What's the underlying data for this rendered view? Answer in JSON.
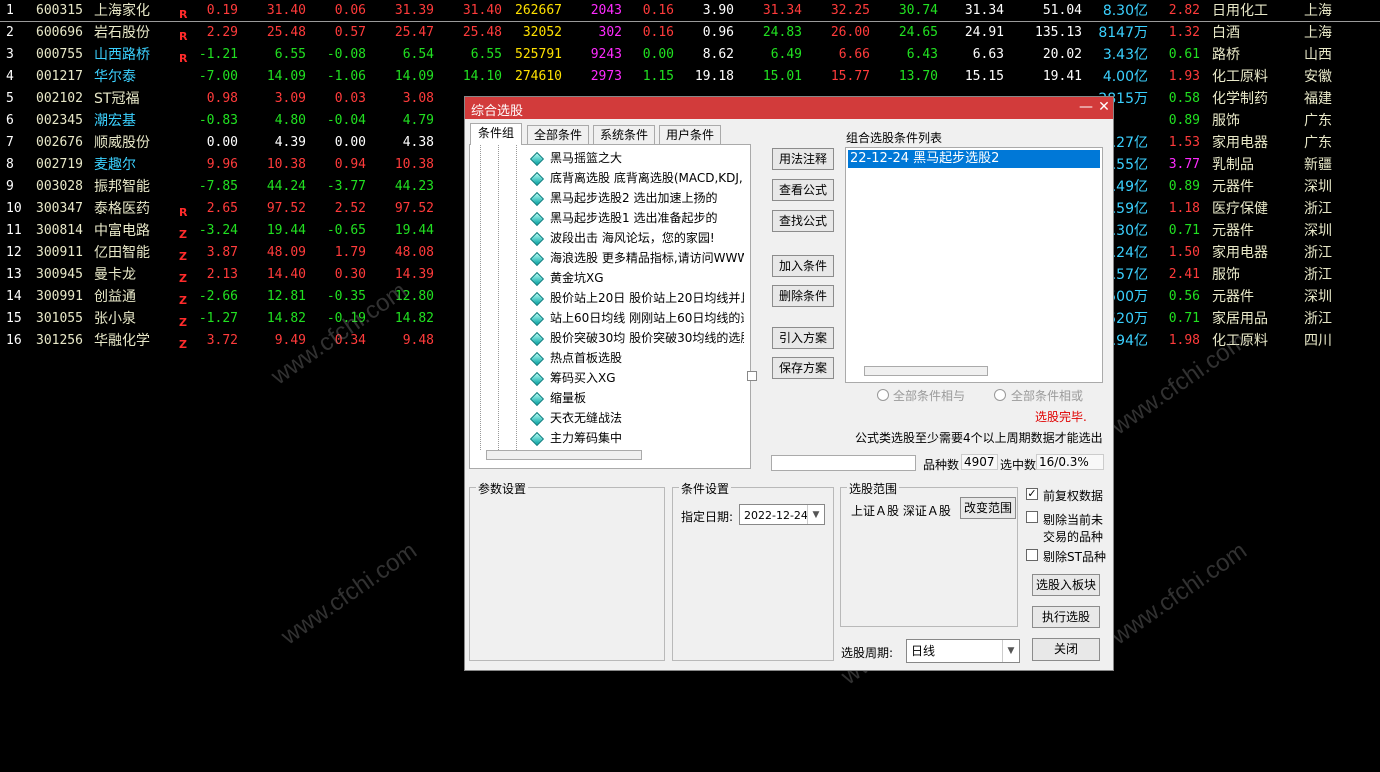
{
  "colors": {
    "up": "#ff3b3b",
    "down": "#21e021",
    "flat": "#ffffff",
    "accent_title": "#d23b3b",
    "selection": "#0078d7"
  },
  "watermark": "www.cfchi.com",
  "stocks": [
    {
      "no": "1",
      "code": "600315",
      "name": "上海家化",
      "flag": "R",
      "chg": "0.19",
      "price": "31.40",
      "delta": "0.06",
      "bid": "31.39",
      "ask": "31.40",
      "vol": "262667",
      "cur": "2043",
      "speed": "0.16",
      "turnover": "3.90",
      "open": "31.34",
      "high": "32.25",
      "low": "30.74",
      "prev": "31.34",
      "pe": "51.04",
      "amount": "8.30亿",
      "ratio": "2.82",
      "industry": "日用化工",
      "region": "上海"
    },
    {
      "no": "2",
      "code": "600696",
      "name": "岩石股份",
      "flag": "R",
      "chg": "2.29",
      "price": "25.48",
      "delta": "0.57",
      "bid": "25.47",
      "ask": "25.48",
      "vol": "32052",
      "cur": "302",
      "speed": "0.16",
      "turnover": "0.96",
      "open": "24.83",
      "high": "26.00",
      "low": "24.65",
      "prev": "24.91",
      "pe": "135.13",
      "amount": "8147万",
      "ratio": "1.32",
      "industry": "白酒",
      "region": "上海"
    },
    {
      "no": "3",
      "code": "000755",
      "name": "山西路桥",
      "flag": "R",
      "chg": "-1.21",
      "price": "6.55",
      "delta": "-0.08",
      "bid": "6.54",
      "ask": "6.55",
      "vol": "525791",
      "cur": "9243",
      "speed": "0.00",
      "turnover": "8.62",
      "open": "6.49",
      "high": "6.66",
      "low": "6.43",
      "prev": "6.63",
      "pe": "20.02",
      "amount": "3.43亿",
      "ratio": "0.61",
      "industry": "路桥",
      "region": "山西"
    },
    {
      "no": "4",
      "code": "001217",
      "name": "华尔泰",
      "flag": "",
      "chg": "-7.00",
      "price": "14.09",
      "delta": "-1.06",
      "bid": "14.09",
      "ask": "14.10",
      "vol": "274610",
      "cur": "2973",
      "speed": "1.15",
      "turnover": "19.18",
      "open": "15.01",
      "high": "15.77",
      "low": "13.70",
      "prev": "15.15",
      "pe": "19.41",
      "amount": "4.00亿",
      "ratio": "1.93",
      "industry": "化工原料",
      "region": "安徽"
    },
    {
      "no": "5",
      "code": "002102",
      "name": "ST冠福",
      "flag": "",
      "chg": "0.98",
      "price": "3.09",
      "delta": "0.03",
      "bid": "3.08",
      "ask": "",
      "vol": "",
      "cur": "",
      "speed": "",
      "turnover": "",
      "open": "",
      "high": "",
      "low": "",
      "prev": "",
      "pe": "",
      "amount": "2815万",
      "ratio": "0.58",
      "industry": "化学制药",
      "region": "福建"
    },
    {
      "no": "6",
      "code": "002345",
      "name": "潮宏基",
      "flag": "",
      "chg": "-0.83",
      "price": "4.80",
      "delta": "-0.04",
      "bid": "4.79",
      "ask": "",
      "vol": "",
      "cur": "",
      "speed": "",
      "turnover": "",
      "open": "",
      "high": "",
      "low": "",
      "prev": "",
      "pe": "",
      "amount": "",
      "ratio": "0.89",
      "industry": "服饰",
      "region": "广东"
    },
    {
      "no": "7",
      "code": "002676",
      "name": "顺威股份",
      "flag": "",
      "chg": "0.00",
      "price": "4.39",
      "delta": "0.00",
      "bid": "4.38",
      "ask": "",
      "vol": "",
      "cur": "",
      "speed": "",
      "turnover": "",
      "open": "",
      "high": "",
      "low": "",
      "prev": "",
      "pe": "",
      "amount": ".27亿",
      "ratio": "1.53",
      "industry": "家用电器",
      "region": "广东"
    },
    {
      "no": "8",
      "code": "002719",
      "name": "麦趣尔",
      "flag": "",
      "chg": "9.96",
      "price": "10.38",
      "delta": "0.94",
      "bid": "10.38",
      "ask": "",
      "vol": "",
      "cur": "",
      "speed": "",
      "turnover": "",
      "open": "",
      "high": "",
      "low": "",
      "prev": "",
      "pe": "",
      "amount": ".55亿",
      "ratio": "3.77",
      "industry": "乳制品",
      "region": "新疆"
    },
    {
      "no": "9",
      "code": "003028",
      "name": "振邦智能",
      "flag": "",
      "chg": "-7.85",
      "price": "44.24",
      "delta": "-3.77",
      "bid": "44.23",
      "ask": "",
      "vol": "",
      "cur": "",
      "speed": "",
      "turnover": "",
      "open": "",
      "high": "",
      "low": "",
      "prev": "",
      "pe": "",
      "amount": ".49亿",
      "ratio": "0.89",
      "industry": "元器件",
      "region": "深圳"
    },
    {
      "no": "10",
      "code": "300347",
      "name": "泰格医药",
      "flag": "R",
      "chg": "2.65",
      "price": "97.52",
      "delta": "2.52",
      "bid": "97.52",
      "ask": "",
      "vol": "",
      "cur": "",
      "speed": "",
      "turnover": "",
      "open": "",
      "high": "",
      "low": "",
      "prev": "",
      "pe": "",
      "amount": ".59亿",
      "ratio": "1.18",
      "industry": "医疗保健",
      "region": "浙江"
    },
    {
      "no": "11",
      "code": "300814",
      "name": "中富电路",
      "flag": "Z",
      "chg": "-3.24",
      "price": "19.44",
      "delta": "-0.65",
      "bid": "19.44",
      "ask": "",
      "vol": "",
      "cur": "",
      "speed": "",
      "turnover": "",
      "open": "",
      "high": "",
      "low": "",
      "prev": "",
      "pe": "",
      "amount": ".30亿",
      "ratio": "0.71",
      "industry": "元器件",
      "region": "深圳"
    },
    {
      "no": "12",
      "code": "300911",
      "name": "亿田智能",
      "flag": "Z",
      "chg": "3.87",
      "price": "48.09",
      "delta": "1.79",
      "bid": "48.08",
      "ask": "",
      "vol": "",
      "cur": "",
      "speed": "",
      "turnover": "",
      "open": "",
      "high": "",
      "low": "",
      "prev": "",
      "pe": "",
      "amount": ".24亿",
      "ratio": "1.50",
      "industry": "家用电器",
      "region": "浙江"
    },
    {
      "no": "13",
      "code": "300945",
      "name": "曼卡龙",
      "flag": "Z",
      "chg": "2.13",
      "price": "14.40",
      "delta": "0.30",
      "bid": "14.39",
      "ask": "",
      "vol": "",
      "cur": "",
      "speed": "",
      "turnover": "",
      "open": "",
      "high": "",
      "low": "",
      "prev": "",
      "pe": "",
      "amount": ".57亿",
      "ratio": "2.41",
      "industry": "服饰",
      "region": "浙江"
    },
    {
      "no": "14",
      "code": "300991",
      "name": "创益通",
      "flag": "Z",
      "chg": "-2.66",
      "price": "12.81",
      "delta": "-0.35",
      "bid": "12.80",
      "ask": "",
      "vol": "",
      "cur": "",
      "speed": "",
      "turnover": "",
      "open": "",
      "high": "",
      "low": "",
      "prev": "",
      "pe": "",
      "amount": "500万",
      "ratio": "0.56",
      "industry": "元器件",
      "region": "深圳"
    },
    {
      "no": "15",
      "code": "301055",
      "name": "张小泉",
      "flag": "Z",
      "chg": "-1.27",
      "price": "14.82",
      "delta": "-0.19",
      "bid": "14.82",
      "ask": "",
      "vol": "",
      "cur": "",
      "speed": "",
      "turnover": "",
      "open": "",
      "high": "",
      "low": "",
      "prev": "",
      "pe": "",
      "amount": "520万",
      "ratio": "0.71",
      "industry": "家居用品",
      "region": "浙江"
    },
    {
      "no": "16",
      "code": "301256",
      "name": "华融化学",
      "flag": "Z",
      "chg": "3.72",
      "price": "9.49",
      "delta": "0.34",
      "bid": "9.48",
      "ask": "",
      "vol": "",
      "cur": "",
      "speed": "",
      "turnover": "",
      "open": "",
      "high": "",
      "low": "",
      "prev": "",
      "pe": "",
      "amount": ".94亿",
      "ratio": "1.98",
      "industry": "化工原料",
      "region": "四川"
    }
  ],
  "dialog": {
    "title": "综合选股",
    "min_label": "—",
    "close_label": "✕",
    "tabs": [
      "条件组",
      "全部条件",
      "系统条件",
      "用户条件"
    ],
    "conditions": [
      "黑马摇篮之大",
      "底背离选股  底背离选股(MACD,KDJ,",
      "黑马起步选股2 选出加速上扬的",
      "黑马起步选股1 选出准备起步的",
      "波段出击 海风论坛，您的家园!",
      "海浪选股 更多精品指标,请访问WWW",
      "黄金坑XG",
      "股价站上20日 股价站上20日均线并且",
      "站上60日均线 刚刚站上60日均线的选",
      "股价突破30均 股价突破30均线的选股",
      "热点首板选股",
      "筹码买入XG",
      "缩量板",
      "天衣无缝战法",
      "主力筹码集中"
    ],
    "buttons": {
      "usage": "用法注释",
      "view": "查看公式",
      "find": "查找公式",
      "add": "加入条件",
      "delete": "删除条件",
      "import": "引入方案",
      "save": "保存方案",
      "change_range": "改变范围",
      "to_block": "选股入板块",
      "execute": "执行选股",
      "close": "关闭"
    },
    "combined_list_label": "组合选股条件列表",
    "combined_items": [
      "22-12-24 黑马起步选股2"
    ],
    "radio_and": "全部条件相与",
    "radio_or": "全部条件相或",
    "status": "选股完毕.",
    "note": "公式类选股至少需要4个以上周期数据才能选出",
    "count_label": "品种数",
    "count_value": "4907",
    "selected_label": "选中数",
    "selected_value": "16/0.3%",
    "param_label": "参数设置",
    "cond_label": "条件设置",
    "date_label": "指定日期:",
    "date_value": "2022-12-24",
    "range_label": "选股范围",
    "range_value": "上证Ａ股 深证Ａ股",
    "chk_fq": "前复权数据",
    "chk_exclude1": "剔除当前未",
    "chk_exclude1b": "交易的品种",
    "chk_st": "剔除ST品种",
    "period_label": "选股周期:",
    "period_value": "日线"
  }
}
